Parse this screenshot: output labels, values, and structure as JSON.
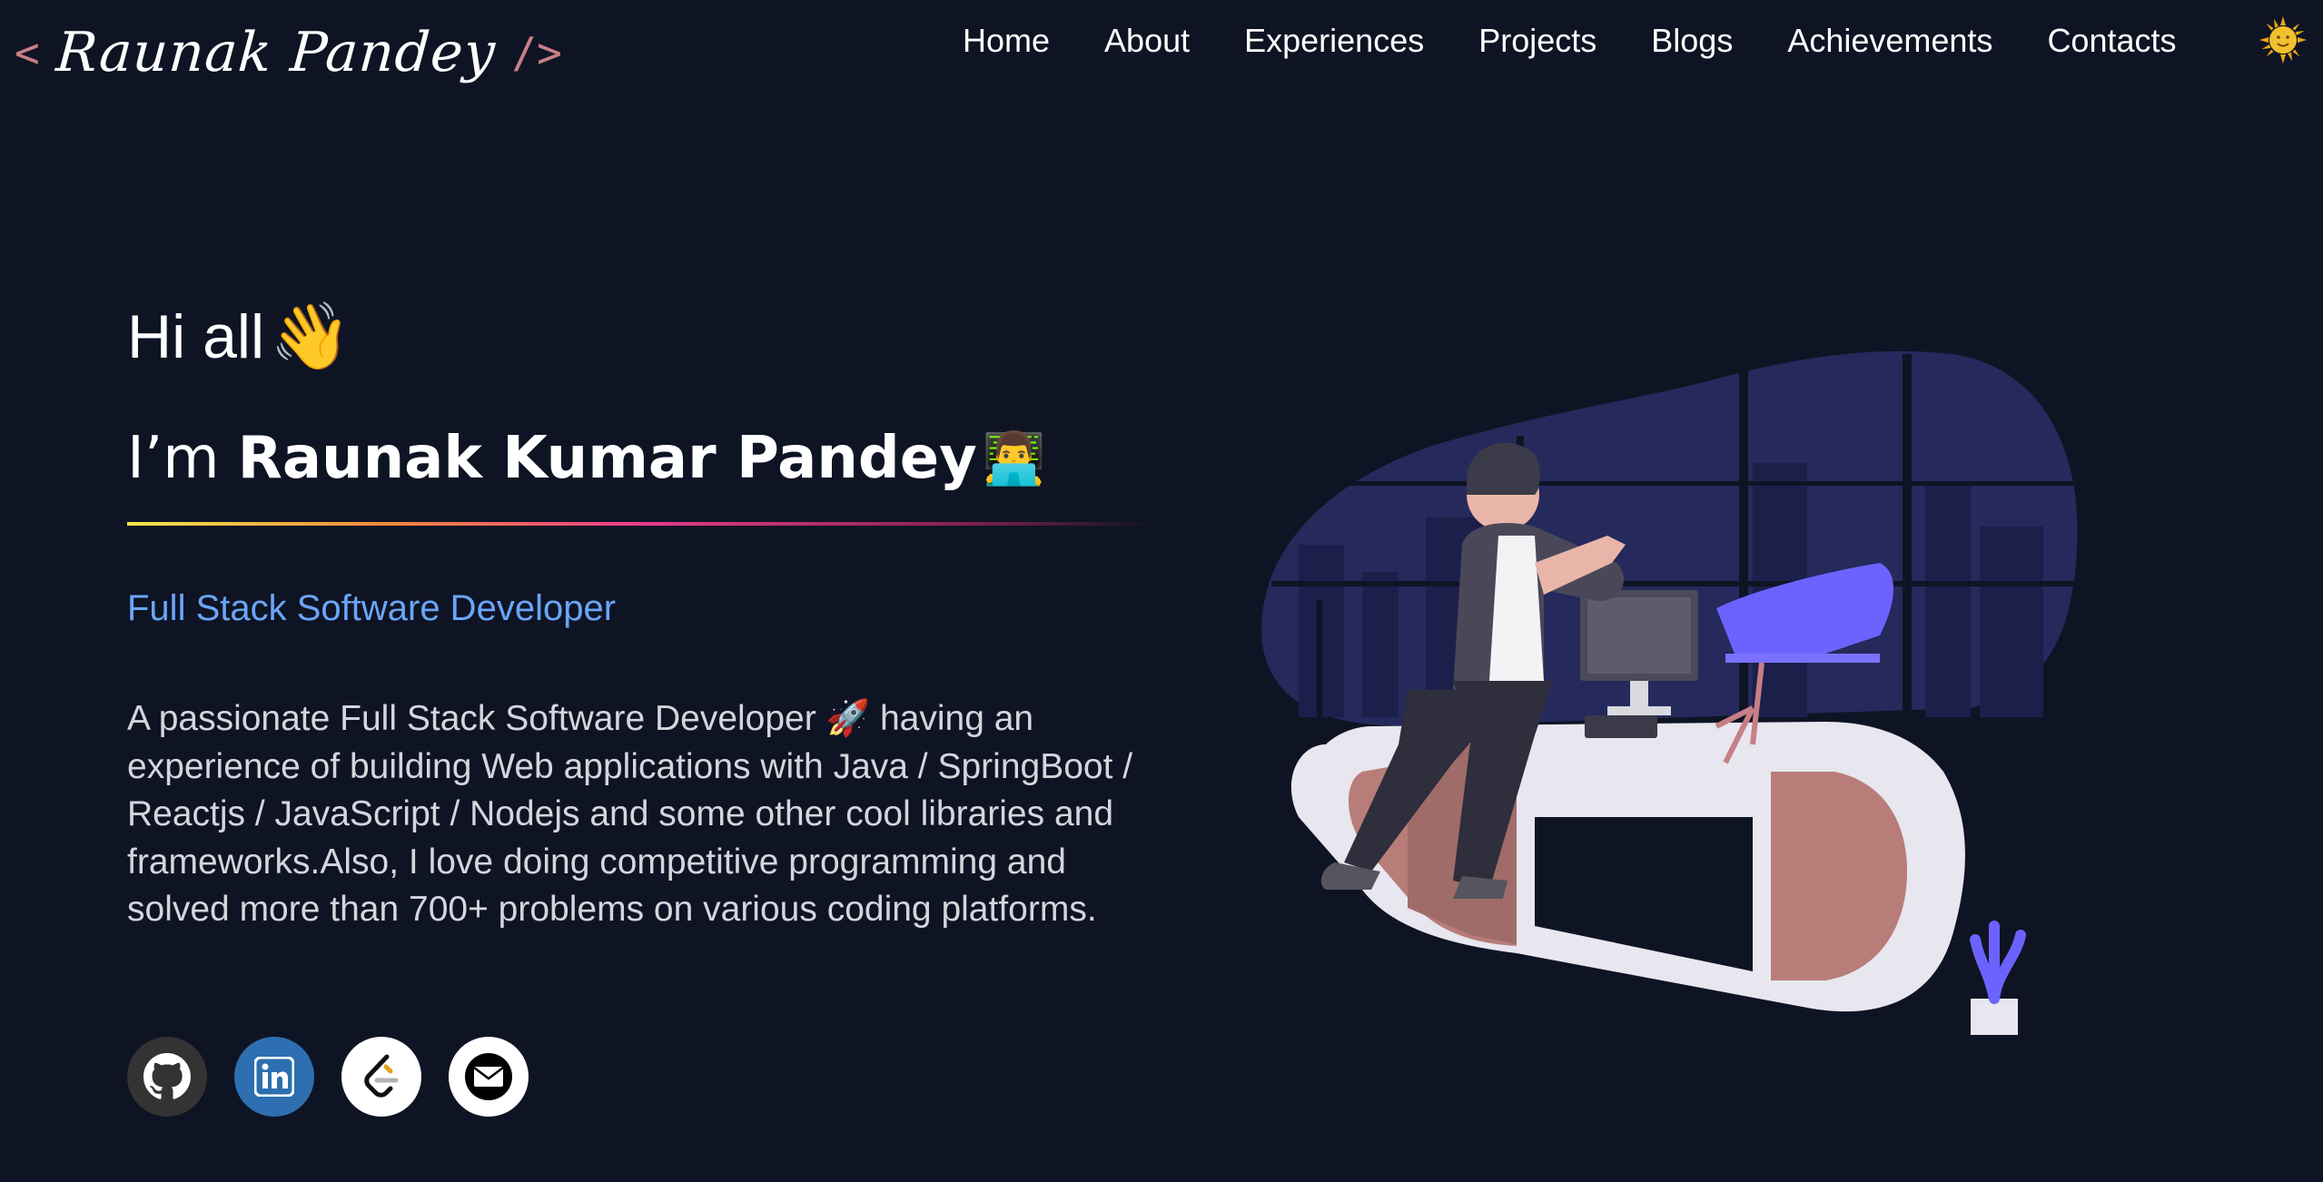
{
  "header": {
    "logo_open": "<",
    "logo_name": "Raunak Pandey",
    "logo_close": "/>",
    "nav": [
      "Home",
      "About",
      "Experiences",
      "Projects",
      "Blogs",
      "Achievements",
      "Contacts"
    ],
    "theme_icon": "sun-icon"
  },
  "hero": {
    "greeting": "Hi all",
    "greeting_emoji": "👋",
    "intro_prefix": "I’m",
    "intro_name": "Raunak Kumar Pandey",
    "intro_emoji": "👨‍💻",
    "role": "Full Stack Software Developer",
    "description": "A passionate Full Stack Software Developer 🚀 having an experience of building Web applications with Java / SpringBoot / Reactjs / JavaScript / Nodejs and some other cool libraries and frameworks.Also, I love doing competitive programming and solved more than 700+ problems on various coding platforms.",
    "socials": [
      {
        "name": "github",
        "icon": "github-icon"
      },
      {
        "name": "linkedin",
        "icon": "linkedin-icon"
      },
      {
        "name": "leetcode",
        "icon": "leetcode-icon"
      },
      {
        "name": "mail",
        "icon": "mail-icon"
      }
    ]
  },
  "colors": {
    "background": "#0f1424",
    "role_accent": "#6aa6f8",
    "logo_bracket": "#c77f86",
    "linkedin": "#2d6fb0",
    "github": "#333333"
  }
}
